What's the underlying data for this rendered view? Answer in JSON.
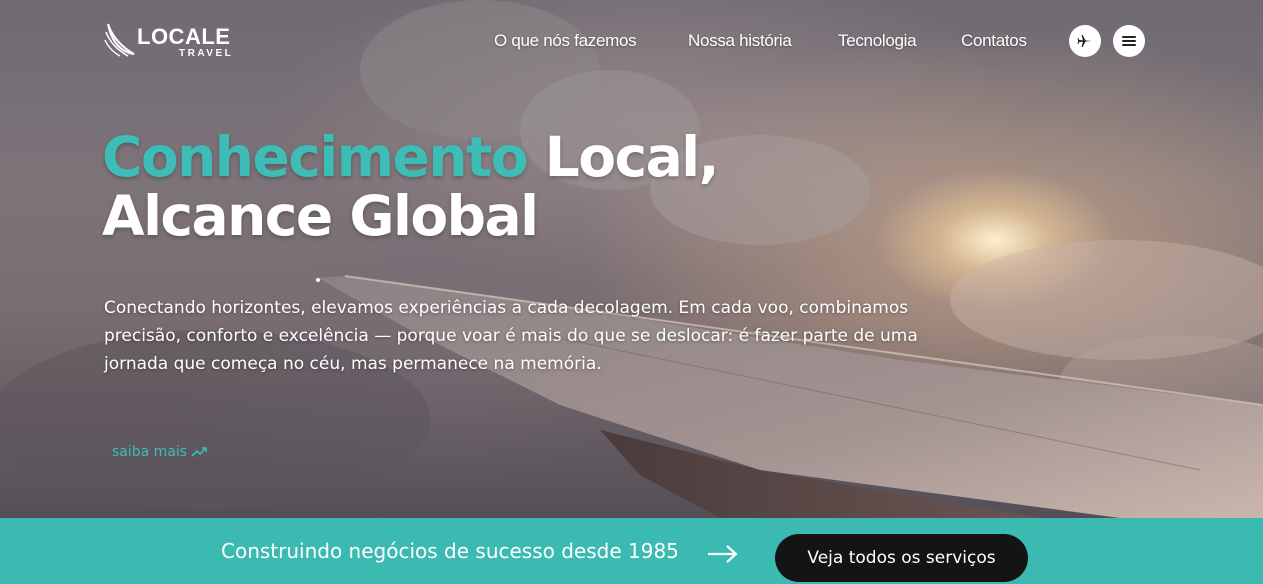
{
  "brand": {
    "name": "LOCALE",
    "tagline": "TRAVEL"
  },
  "nav": {
    "items": [
      {
        "label": "O que nós fazemos"
      },
      {
        "label": "Nossa história"
      },
      {
        "label": "Tecnologia"
      },
      {
        "label": "Contatos"
      }
    ],
    "icons": [
      "airplane-icon",
      "menu-icon"
    ]
  },
  "hero": {
    "headline_accent": "Conhecimento",
    "headline_rest": " Local,",
    "headline_line2": "Alcance Global",
    "description": "Conectando horizontes, elevamos experiências a cada decolagem. Em cada voo, combinamos precisão, conforto e excelência — porque voar é mais do que se deslocar: é fazer parte de uma jornada que começa no céu, mas permanece na memória.",
    "link_label": "saiba mais",
    "link_icon": "trending-up-arrow-icon"
  },
  "banner": {
    "text": "Construindo negócios de sucesso desde 1985",
    "arrow_icon": "arrow-right-icon",
    "button_label": "Veja todos os serviços"
  },
  "colors": {
    "accent": "#3dbdb5",
    "banner_bg": "#3bbab1",
    "button_bg": "#141414",
    "text": "#ffffff"
  }
}
